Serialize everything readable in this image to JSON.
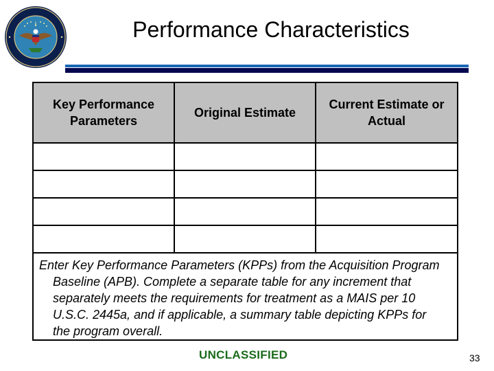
{
  "slide": {
    "title": "Performance Characteristics",
    "logo_icon": "department-of-defense-seal-icon",
    "classification": "UNCLASSIFIED",
    "page_number": "33",
    "colors": {
      "rule_light": "#1a67b5",
      "rule_dark": "#04084f",
      "header_fill": "#c0c0c0",
      "classification_text": "#1a6b1a"
    }
  },
  "table": {
    "headers": [
      "Key Performance Parameters",
      "Original Estimate",
      "Current Estimate or Actual"
    ],
    "rows": [
      [
        "",
        "",
        ""
      ],
      [
        "",
        "",
        ""
      ],
      [
        "",
        "",
        ""
      ],
      [
        "",
        "",
        ""
      ]
    ],
    "note": "Enter Key Performance Parameters (KPPs) from the Acquisition Program Baseline (APB).  Complete a separate table for any increment that separately meets the requirements for treatment as a MAIS per 10 U.S.C. 2445a, and if applicable, a summary table depicting KPPs for the program overall."
  }
}
